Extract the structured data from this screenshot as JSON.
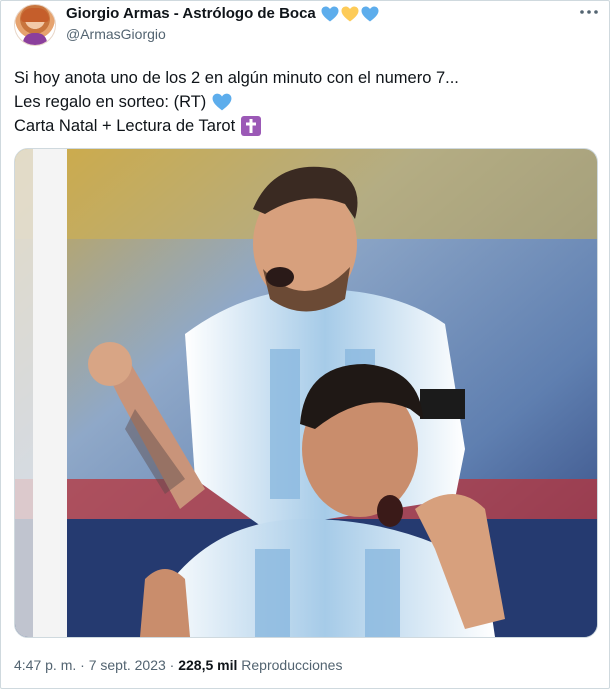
{
  "author": {
    "name": "Giorgio Armas - Astrólogo de Boca",
    "handle": "@ArmasGiorgio",
    "name_emojis": [
      "blue-heart",
      "yellow-heart",
      "blue-heart"
    ]
  },
  "tweet": {
    "lines": [
      "Si hoy anota uno de los 2 en algún minuto con el numero 7...",
      "Les regalo en sorteo: (RT)",
      "Carta Natal + Lectura de Tarot"
    ],
    "line_emojis": [
      "",
      "blue-heart",
      "latin-cross"
    ]
  },
  "media": {
    "description_icons": [
      "soccer-players-photo"
    ]
  },
  "meta": {
    "time": "4:47 p. m.",
    "separator": "·",
    "date": "7 sept. 2023",
    "views_count": "228,5 mil",
    "views_label": "Reproducciones"
  },
  "colors": {
    "text": "#0f1419",
    "secondary": "#536471",
    "border": "#cfd9de",
    "heart_blue": "#5dadec",
    "heart_yellow": "#fdcb58",
    "cross_purple": "#9b59b6"
  }
}
